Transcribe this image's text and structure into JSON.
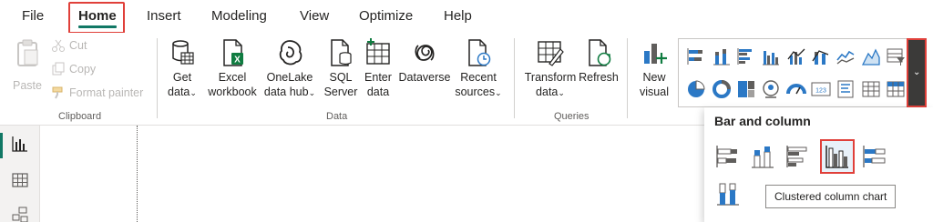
{
  "menu": {
    "tabs": [
      "File",
      "Home",
      "Insert",
      "Modeling",
      "View",
      "Optimize",
      "Help"
    ],
    "active_tab": "Home"
  },
  "ribbon": {
    "clipboard": {
      "paste": "Paste",
      "cut": "Cut",
      "copy": "Copy",
      "format_painter": "Format painter",
      "label": "Clipboard"
    },
    "data": {
      "get_data_line1": "Get",
      "get_data_line2": "data",
      "excel_line1": "Excel",
      "excel_line2": "workbook",
      "onelake_line1": "OneLake",
      "onelake_line2": "data hub",
      "sql_line1": "SQL",
      "sql_line2": "Server",
      "enter_line1": "Enter",
      "enter_line2": "data",
      "dataverse": "Dataverse",
      "recent_line1": "Recent",
      "recent_line2": "sources",
      "label": "Data"
    },
    "queries": {
      "transform_line1": "Transform",
      "transform_line2": "data",
      "refresh": "Refresh",
      "label": "Queries"
    },
    "insert": {
      "new_visual_line1": "New",
      "new_visual_line2": "visual"
    }
  },
  "flyout": {
    "title": "Bar and column",
    "tooltip": "Clustered column chart"
  },
  "colors": {
    "accent": "#117865",
    "highlight": "#e0403a",
    "chart_blue": "#2b78c5",
    "chart_gray": "#605e5c"
  }
}
